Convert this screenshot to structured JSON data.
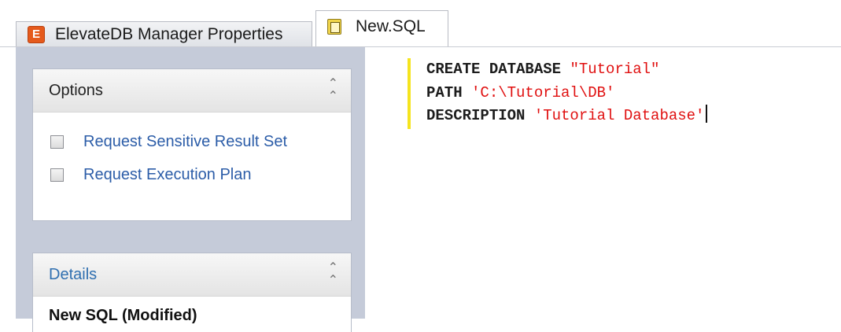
{
  "tabs": [
    {
      "label": "ElevateDB Manager Properties",
      "icon": "elevatedb-app-icon",
      "active": false
    },
    {
      "label": "New.SQL",
      "icon": "sql-document-icon",
      "active": true
    }
  ],
  "sidebar": {
    "options": {
      "title": "Options",
      "items": [
        {
          "label": "Request Sensitive Result Set",
          "checked": false
        },
        {
          "label": "Request Execution Plan",
          "checked": false
        }
      ]
    },
    "details": {
      "title": "Details",
      "text": "New SQL (Modified)"
    }
  },
  "editor": {
    "lines": [
      {
        "keyword": "CREATE DATABASE ",
        "string": "\"Tutorial\""
      },
      {
        "keyword": "PATH ",
        "string": "'C:\\Tutorial\\DB'"
      },
      {
        "keyword": "DESCRIPTION ",
        "string": "'Tutorial Database'"
      }
    ]
  },
  "colors": {
    "accent": "#e55a1c",
    "link": "#2f6fb0",
    "string": "#e01010",
    "modified_marker": "#f5e41e",
    "panel_bg": "#c5cbd9"
  }
}
